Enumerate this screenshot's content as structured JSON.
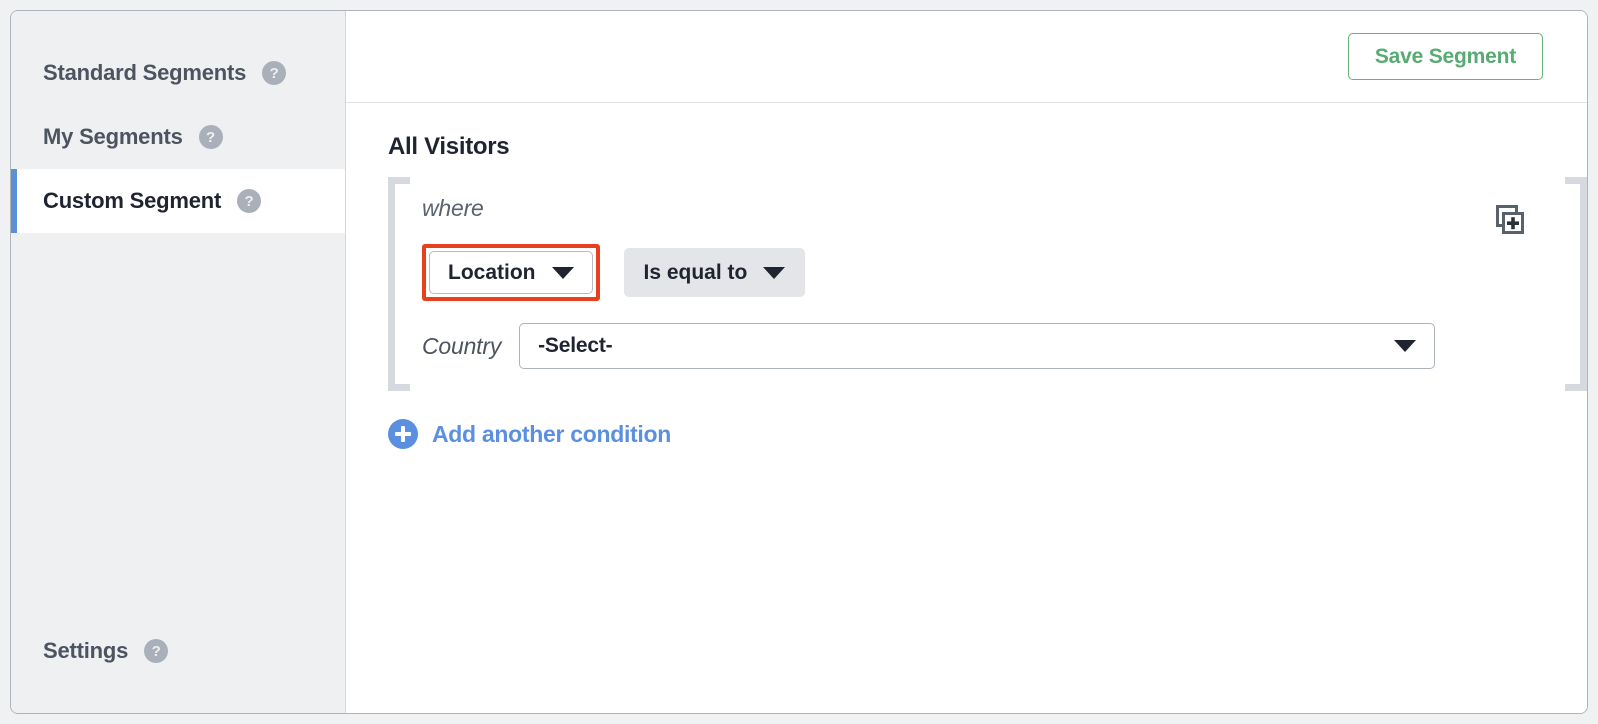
{
  "sidebar": {
    "items": [
      {
        "label": "Standard Segments",
        "help_icon": "help-circle-icon",
        "help_text": "?",
        "active": false
      },
      {
        "label": "My Segments",
        "help_icon": "help-circle-icon",
        "help_text": "?",
        "active": false
      },
      {
        "label": "Custom Segment",
        "help_icon": "help-circle-icon",
        "help_text": "?",
        "active": true
      }
    ],
    "bottom": {
      "label": "Settings",
      "help_icon": "help-circle-icon",
      "help_text": "?"
    },
    "active_accent_color": "#5b8fd6"
  },
  "header": {
    "save_label": "Save Segment",
    "save_color": "#58ab72"
  },
  "main": {
    "segment_title": "All Visitors",
    "where_label": "where",
    "condition": {
      "dimension_label": "Location",
      "dimension_caret": "chevron-down-icon",
      "operator_label": "Is equal to",
      "operator_caret": "chevron-down-icon",
      "value_field_label": "Country",
      "value_selected": "-Select-",
      "value_caret": "chevron-down-icon",
      "highlight_color": "#e8401e"
    },
    "group_action_icon": "duplicate-group-icon",
    "add_condition": {
      "icon": "plus-circle-icon",
      "label": "Add another condition",
      "color": "#5b90e0"
    }
  }
}
